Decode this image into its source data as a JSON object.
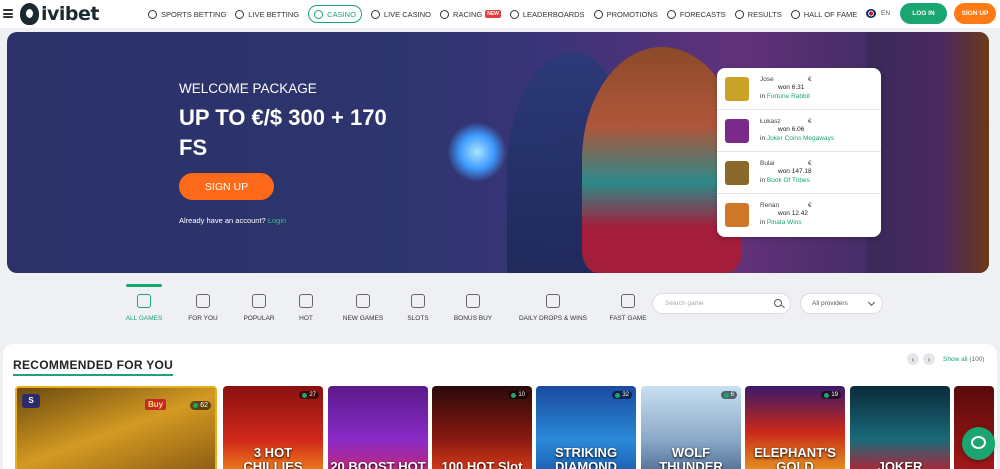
{
  "header": {
    "brand": "ivibet",
    "nav": [
      {
        "label": "SPORTS BETTING",
        "icon": "soccer-ball-icon"
      },
      {
        "label": "LIVE BETTING",
        "icon": "flame-icon"
      },
      {
        "label": "CASINO",
        "icon": "casino-chip-icon",
        "active": true
      },
      {
        "label": "LIVE CASINO",
        "icon": "cards-icon"
      },
      {
        "label": "RACING",
        "icon": "horse-icon",
        "badge": "NEW"
      },
      {
        "label": "LEADERBOARDS",
        "icon": "trophy-icon"
      },
      {
        "label": "PROMOTIONS",
        "icon": "gift-icon"
      },
      {
        "label": "FORECASTS",
        "icon": "chart-icon"
      },
      {
        "label": "RESULTS",
        "icon": "list-icon"
      },
      {
        "label": "HALL OF FAME",
        "icon": "crown-icon"
      }
    ],
    "language": "EN",
    "login_label": "LOG IN",
    "signup_label": "SIGN UP",
    "accent_color": "#1aa571",
    "signup_color": "#ff7a14"
  },
  "banner": {
    "subtitle": "WELCOME PACKAGE",
    "headline": "UP TO €/$ 300 + 170 FS",
    "signup_label": "SIGN UP",
    "account_text": "Already have an account?",
    "login_link": "Login"
  },
  "winners": [
    {
      "name": "Jose",
      "currency": "€",
      "amount": "won 6.31",
      "in": "in",
      "game": "Fortune Rabbit",
      "thumb": "#c9a227"
    },
    {
      "name": "Łukasz",
      "currency": "€",
      "amount": "won 6.06",
      "in": "in",
      "game": "Joker Coins Megaways",
      "thumb": "#7a2a8a"
    },
    {
      "name": "Bulai",
      "currency": "€",
      "amount": "won 147.18",
      "in": "in",
      "game": "Book Of Tribes",
      "thumb": "#8a6a2a"
    },
    {
      "name": "Renan",
      "currency": "€",
      "amount": "won 12.42",
      "in": "in",
      "game": "Pinata Wins",
      "thumb": "#d0782a"
    }
  ],
  "categories": [
    {
      "label": "ALL GAMES",
      "icon": "dice-icon",
      "active": true
    },
    {
      "label": "FOR YOU",
      "icon": "sparkle-icon"
    },
    {
      "label": "POPULAR",
      "icon": "crown-icon"
    },
    {
      "label": "HOT",
      "icon": "chili-icon"
    },
    {
      "label": "NEW GAMES",
      "icon": "star-icon"
    },
    {
      "label": "SLOTS",
      "icon": "cherries-icon"
    },
    {
      "label": "BONUS BUY",
      "icon": "money-bag-icon"
    },
    {
      "label": "DAILY DROPS & WINS",
      "icon": "cake-icon"
    },
    {
      "label": "FAST GAME",
      "icon": "lightning-icon"
    }
  ],
  "search": {
    "placeholder": "Search game"
  },
  "providers": {
    "label": "All providers"
  },
  "recommended": {
    "title": "RECOMMENDED FOR YOU",
    "show_all": "Show all",
    "count": "(100)",
    "games": [
      {
        "title": "",
        "players": "62",
        "buy": "Buy",
        "badge": "S",
        "bg": "linear-gradient(160deg,#6b4a10,#d49a22 50%,#8a5a12)"
      },
      {
        "title": "3 HOT CHILLIES",
        "players": "27",
        "bg": "linear-gradient(180deg,#8a1010,#d0281a 60%,#f08a1a)"
      },
      {
        "title": "20 BOOST HOT",
        "players": "",
        "bg": "linear-gradient(180deg,#5a1a8a,#8a2ac8 60%,#c8286a)"
      },
      {
        "title": "100 HOT Slot",
        "players": "10",
        "bg": "linear-gradient(180deg,#2a0a0a,#8a1a10 60%,#e0401a)"
      },
      {
        "title": "STRIKING DIAMOND",
        "players": "32",
        "bg": "linear-gradient(180deg,#1a4aa0,#2a8ad8 60%,#1a5ab0)"
      },
      {
        "title": "WOLF THUNDER",
        "players": "6",
        "bg": "linear-gradient(180deg,#c8e0f0,#8aa8c8 60%,#4a6a90)"
      },
      {
        "title": "ELEPHANT'S GOLD",
        "players": "19",
        "bg": "linear-gradient(180deg,#3a1a6a,#c8281a 50%,#e8a020)"
      },
      {
        "title": "JOKER",
        "players": "",
        "bg": "linear-gradient(180deg,#0a2a3a,#1a6a7a 60%,#c81a2a)"
      },
      {
        "title": "",
        "players": "",
        "bg": "linear-gradient(180deg,#5a0a0a,#a81a1a)"
      }
    ]
  }
}
